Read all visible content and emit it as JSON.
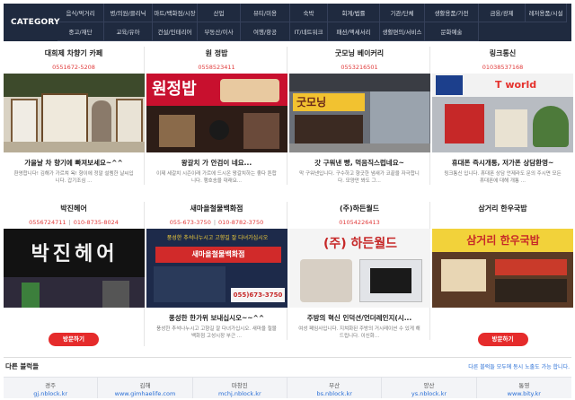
{
  "category": {
    "title": "CATEGORY",
    "items": [
      "음식/먹거리",
      "병/의원/클리닉",
      "마트/백화점/시장",
      "산업",
      "뷰티/미용",
      "숙박",
      "회계/법률",
      "기관/단체",
      "생활용품/가전",
      "금융/광제",
      "레저용품/시설",
      "중고/재단",
      "교육/유아",
      "건설/인테리어",
      "부동산/이사",
      "여행/항공",
      "IT/네트워크",
      "패션/액세서리",
      "생활편의/서비스",
      "문화예술"
    ]
  },
  "cards": [
    {
      "name": "대희제 차향기 카페",
      "phones": [
        "0551672-5208"
      ],
      "title": "가을날 차 향기에 빠져보세요~^^",
      "text": "환영합니다! 김해가 가르쳐 욕! 향이에 정말 설렘한 날씨입니다. 갑기조심 ..."
    },
    {
      "name": "원 정밥",
      "phones": [
        "0558523411"
      ],
      "title": "왕갈치 가 안검이 네요...",
      "text": "이제 세갈치 시즌이래 가르에 드시온 왕갈치하는 좋다 튼합니다. 행호송을 대래요..."
    },
    {
      "name": "굿모닝 베이커리",
      "phones": [
        "0553216501"
      ],
      "title": "갓 구워낸 빵, 먹음직스럽네요~",
      "text": "막 구워낸입니다. 구수하고 향긋한 냄새가 코끝을 자극합니다. 모양만 봐도 그..."
    },
    {
      "name": "링크통신",
      "phones": [
        "01038537168"
      ],
      "title": "휴대폰 즉시개통, 저가폰 상담환영~",
      "text": "링크통신 입니다. 휴대폰 상담 언제라도 문의 주시면 모든 휴대폰에 대해 개통 ..."
    },
    {
      "name": "박진헤어",
      "phones": [
        "0556724711",
        "010-8735-8024"
      ],
      "title": "",
      "text": "",
      "button": "방문하기"
    },
    {
      "name": "새마을철물백화점",
      "phones": [
        "055-673-3750",
        "010-8782-3750"
      ],
      "title": "풍성한 한가위 보내십시오~~^^",
      "text": "풍성한 추석나누시고 고향길 잘 다녀가십시오. 새마을 철물백화점 고성시장 부근 ..."
    },
    {
      "name": "(주)하든월드",
      "phones": [
        "01054226413"
      ],
      "title": "주방의 혁신 인덕션/언더레인지(시...",
      "text": "여성 페임사입니다. 지쳐화된 주방의 거시레이션 수 있게 해드립니다. 이신화..."
    },
    {
      "name": "삼거리 한우국밥",
      "phones": [],
      "title": "",
      "text": "",
      "button": "방문하기"
    }
  ],
  "other": {
    "title": "다른 블럭들",
    "note": "다른 블럭들 모두에 동시 노출도 가능 합니다."
  },
  "blogs": [
    {
      "city": "경주",
      "url": "gj.nblock.kr"
    },
    {
      "city": "김해",
      "url": "www.gimhaelife.com"
    },
    {
      "city": "마창진",
      "url": "mchj.nblock.kr"
    },
    {
      "city": "부산",
      "url": "bs.nblock.kr"
    },
    {
      "city": "양산",
      "url": "ys.nblock.kr"
    },
    {
      "city": "통영",
      "url": "www.bity.kr"
    }
  ],
  "signs": {
    "wonjung": "원정밥",
    "goodmorning": "굿모닝",
    "tworld": "T world",
    "bakjin": "박진헤어",
    "saemaeul_top": "풍성한 추석나누시고 고향길 잘 다녀가십시오",
    "saemaeul_sign": "새마을철물백화점",
    "saemaeul_phone": "055)673-3750",
    "hadeun_brand": "(주) 하든월드",
    "samgeori": "삼거리 한우국밥"
  },
  "colors": {
    "nav_bg": "#1f2a3f",
    "accent_red": "#e52b2b",
    "link_blue": "#2a6fd6"
  }
}
